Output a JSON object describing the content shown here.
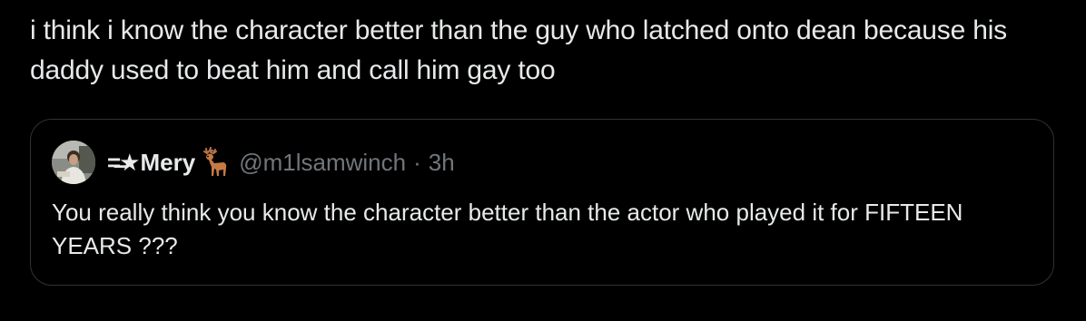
{
  "tweet": {
    "text": "i think i know the character better than the guy who latched onto dean because his daddy used to beat him and call him gay too"
  },
  "quoted_tweet": {
    "name_prefix": "=̶★",
    "display_name": "Mery",
    "username": "@m1lsamwinch",
    "separator": "·",
    "time": "3h",
    "text": "You really think you know the character better than the actor who played it for FIFTEEN YEARS ???"
  },
  "colors": {
    "background": "#000000",
    "text_primary": "#e7e9ea",
    "text_secondary": "#71767b",
    "border": "#2f3336"
  },
  "icons": {
    "avatar": "avatar",
    "name_emoji": "deer-icon"
  }
}
